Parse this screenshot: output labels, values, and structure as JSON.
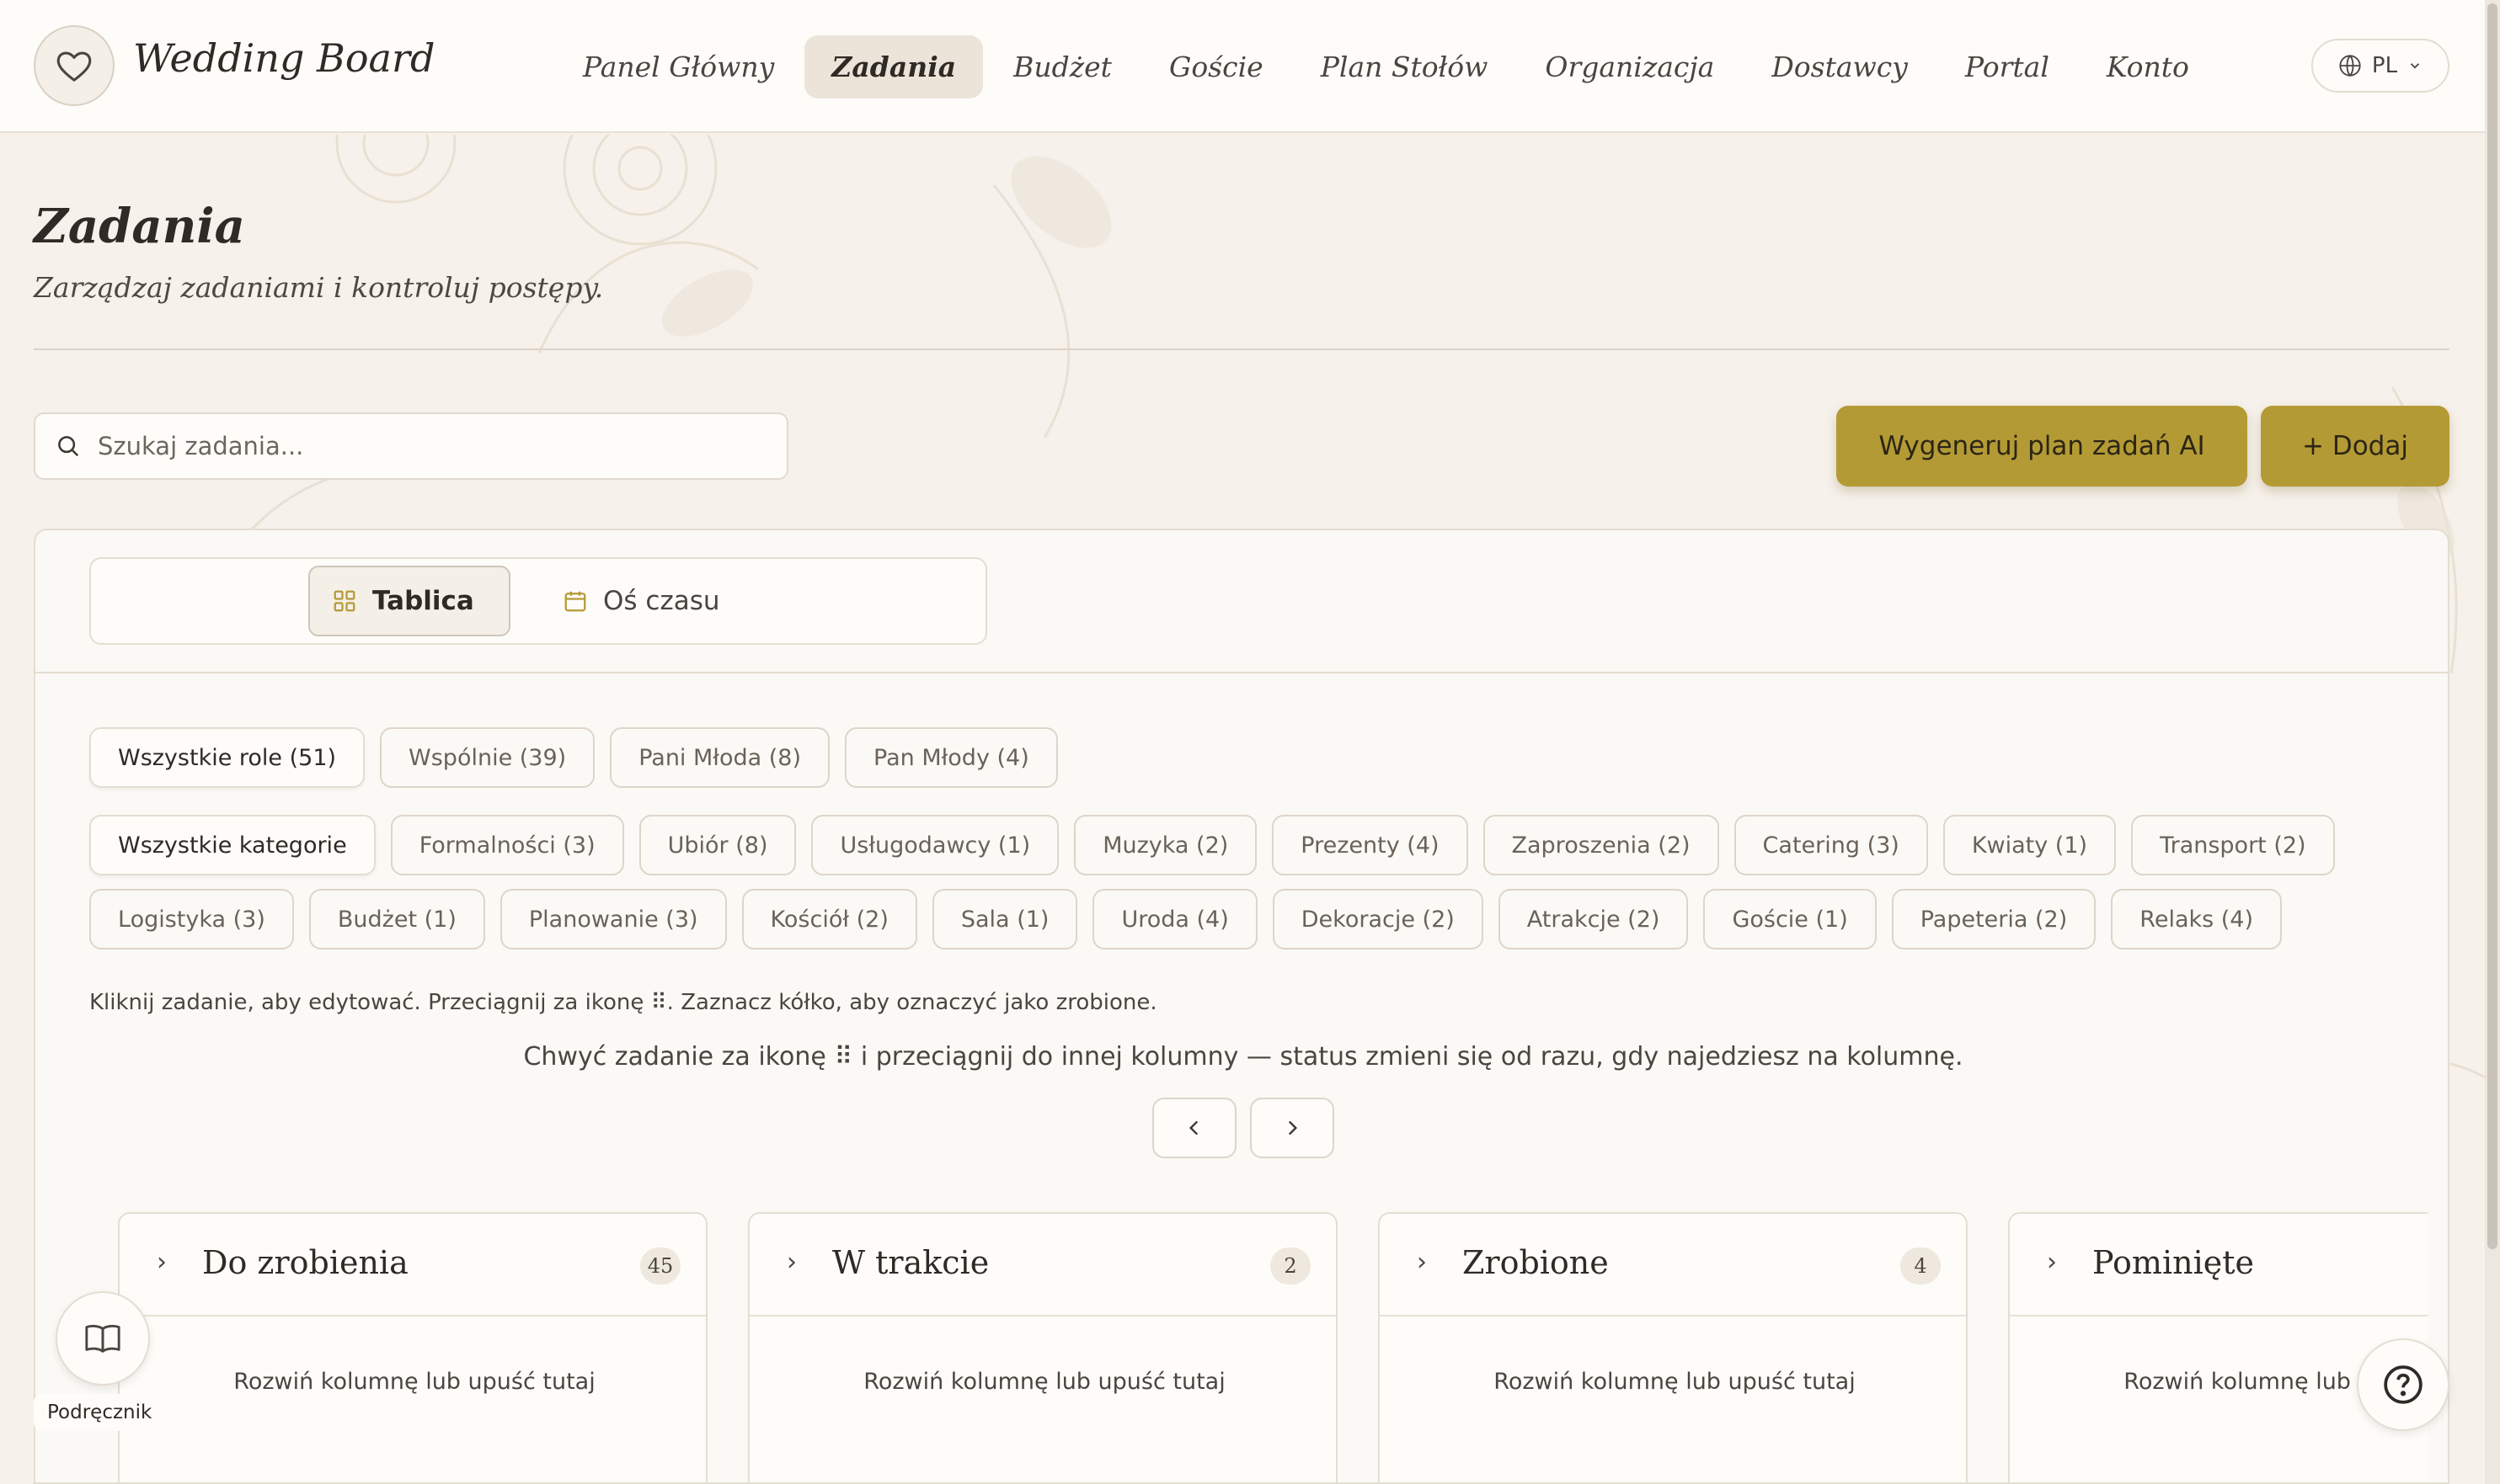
{
  "app": {
    "brand": "Wedding Board"
  },
  "nav": {
    "items": [
      "Panel Główny",
      "Zadania",
      "Budżet",
      "Goście",
      "Plan Stołów",
      "Organizacja",
      "Dostawcy",
      "Portal",
      "Konto"
    ],
    "active": "Zadania",
    "language": "PL"
  },
  "header": {
    "title": "Zadania",
    "subtitle": "Zarządzaj zadaniami i kontroluj postępy."
  },
  "search": {
    "placeholder": "Szukaj zadania..."
  },
  "actions": {
    "ai_plan": "Wygeneruj plan zadań AI",
    "add": "+ Dodaj"
  },
  "views": {
    "board": "Tablica",
    "timeline": "Oś czasu",
    "active": "Tablica"
  },
  "roles": [
    "Wszystkie role (51)",
    "Wspólnie (39)",
    "Pani Młoda (8)",
    "Pan Młody (4)"
  ],
  "categories_row1": [
    "Wszystkie kategorie",
    "Formalności (3)",
    "Ubiór (8)",
    "Usługodawcy (1)",
    "Muzyka (2)",
    "Prezenty (4)",
    "Zaproszenia (2)",
    "Catering (3)",
    "Kwiaty (1)",
    "Transport (2)"
  ],
  "categories_row2": [
    "Logistyka (3)",
    "Budżet (1)",
    "Planowanie (3)",
    "Kościół (2)",
    "Sala (1)",
    "Uroda (4)",
    "Dekoracje (2)",
    "Atrakcje (2)",
    "Goście (1)",
    "Papeteria (2)",
    "Relaks (4)"
  ],
  "hint": "Kliknij zadanie, aby edytować. Przeciągnij za ikonę ⠿. Zaznacz kółko, aby oznaczyć jako zrobione.",
  "instruction": "Chwyć zadanie za ikonę ⠿ i przeciągnij do innej kolumny — status zmieni się od razu, gdy najedziesz na kolumnę.",
  "columns": [
    {
      "title": "Do zrobienia",
      "count": "45",
      "empty": "Rozwiń kolumnę lub upuść tutaj"
    },
    {
      "title": "W trakcie",
      "count": "2",
      "empty": "Rozwiń kolumnę lub upuść tutaj"
    },
    {
      "title": "Zrobione",
      "count": "4",
      "empty": "Rozwiń kolumnę lub upuść tutaj"
    },
    {
      "title": "Pominięte",
      "count": "",
      "empty": "Rozwiń kolumnę lub upuść tutaj"
    }
  ],
  "floating": {
    "handbook": "Podręcznik"
  },
  "colors": {
    "accent": "#b49a35",
    "background": "#f6f1ea",
    "card": "#fbf9f5"
  }
}
